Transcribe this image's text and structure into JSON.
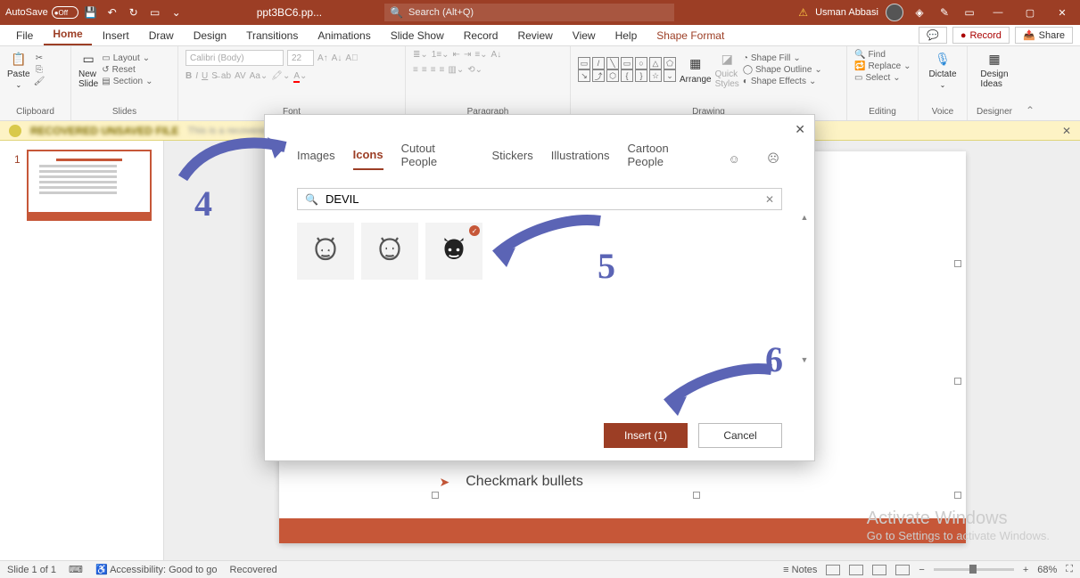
{
  "titlebar": {
    "autosave_label": "AutoSave",
    "autosave_state": "Off",
    "doc_name": "ppt3BC6.pp...",
    "search_placeholder": "Search (Alt+Q)",
    "user_name": "Usman Abbasi"
  },
  "tabs": {
    "file": "File",
    "home": "Home",
    "insert": "Insert",
    "draw": "Draw",
    "design": "Design",
    "transitions": "Transitions",
    "animations": "Animations",
    "slideshow": "Slide Show",
    "record": "Record",
    "review": "Review",
    "view": "View",
    "help": "Help",
    "shapefmt": "Shape Format",
    "record_btn": "Record",
    "share_btn": "Share"
  },
  "ribbon": {
    "paste": "Paste",
    "clipboard": "Clipboard",
    "newslide": "New\nSlide",
    "layout": "Layout",
    "reset": "Reset",
    "section": "Section",
    "slides": "Slides",
    "font_name": "Calibri (Body)",
    "font_size": "22",
    "font_group": "Font",
    "para_group": "Paragraph",
    "arrange": "Arrange",
    "quick": "Quick\nStyles",
    "shape_fill": "Shape Fill",
    "shape_outline": "Shape Outline",
    "shape_effects": "Shape Effects",
    "drawing": "Drawing",
    "find": "Find",
    "replace": "Replace",
    "select": "Select",
    "editing": "Editing",
    "dictate": "Dictate",
    "voice": "Voice",
    "design_ideas": "Design\nIdeas",
    "designer": "Designer"
  },
  "dialog": {
    "tabs": {
      "images": "Images",
      "icons": "Icons",
      "cutout": "Cutout People",
      "stickers": "Stickers",
      "illustrations": "Illustrations",
      "cartoon": "Cartoon People"
    },
    "search_value": "DEVIL",
    "insert_btn": "Insert (1)",
    "cancel_btn": "Cancel"
  },
  "slide": {
    "bullet_text": "Checkmark bullets"
  },
  "watermark": {
    "line1": "Activate Windows",
    "line2": "Go to Settings to activate Windows."
  },
  "status": {
    "slide": "Slide 1 of 1",
    "access": "Accessibility: Good to go",
    "recovered": "Recovered",
    "notes": "Notes",
    "zoom": "68%"
  },
  "anno": {
    "n4": "4",
    "n5": "5",
    "n6": "6"
  }
}
